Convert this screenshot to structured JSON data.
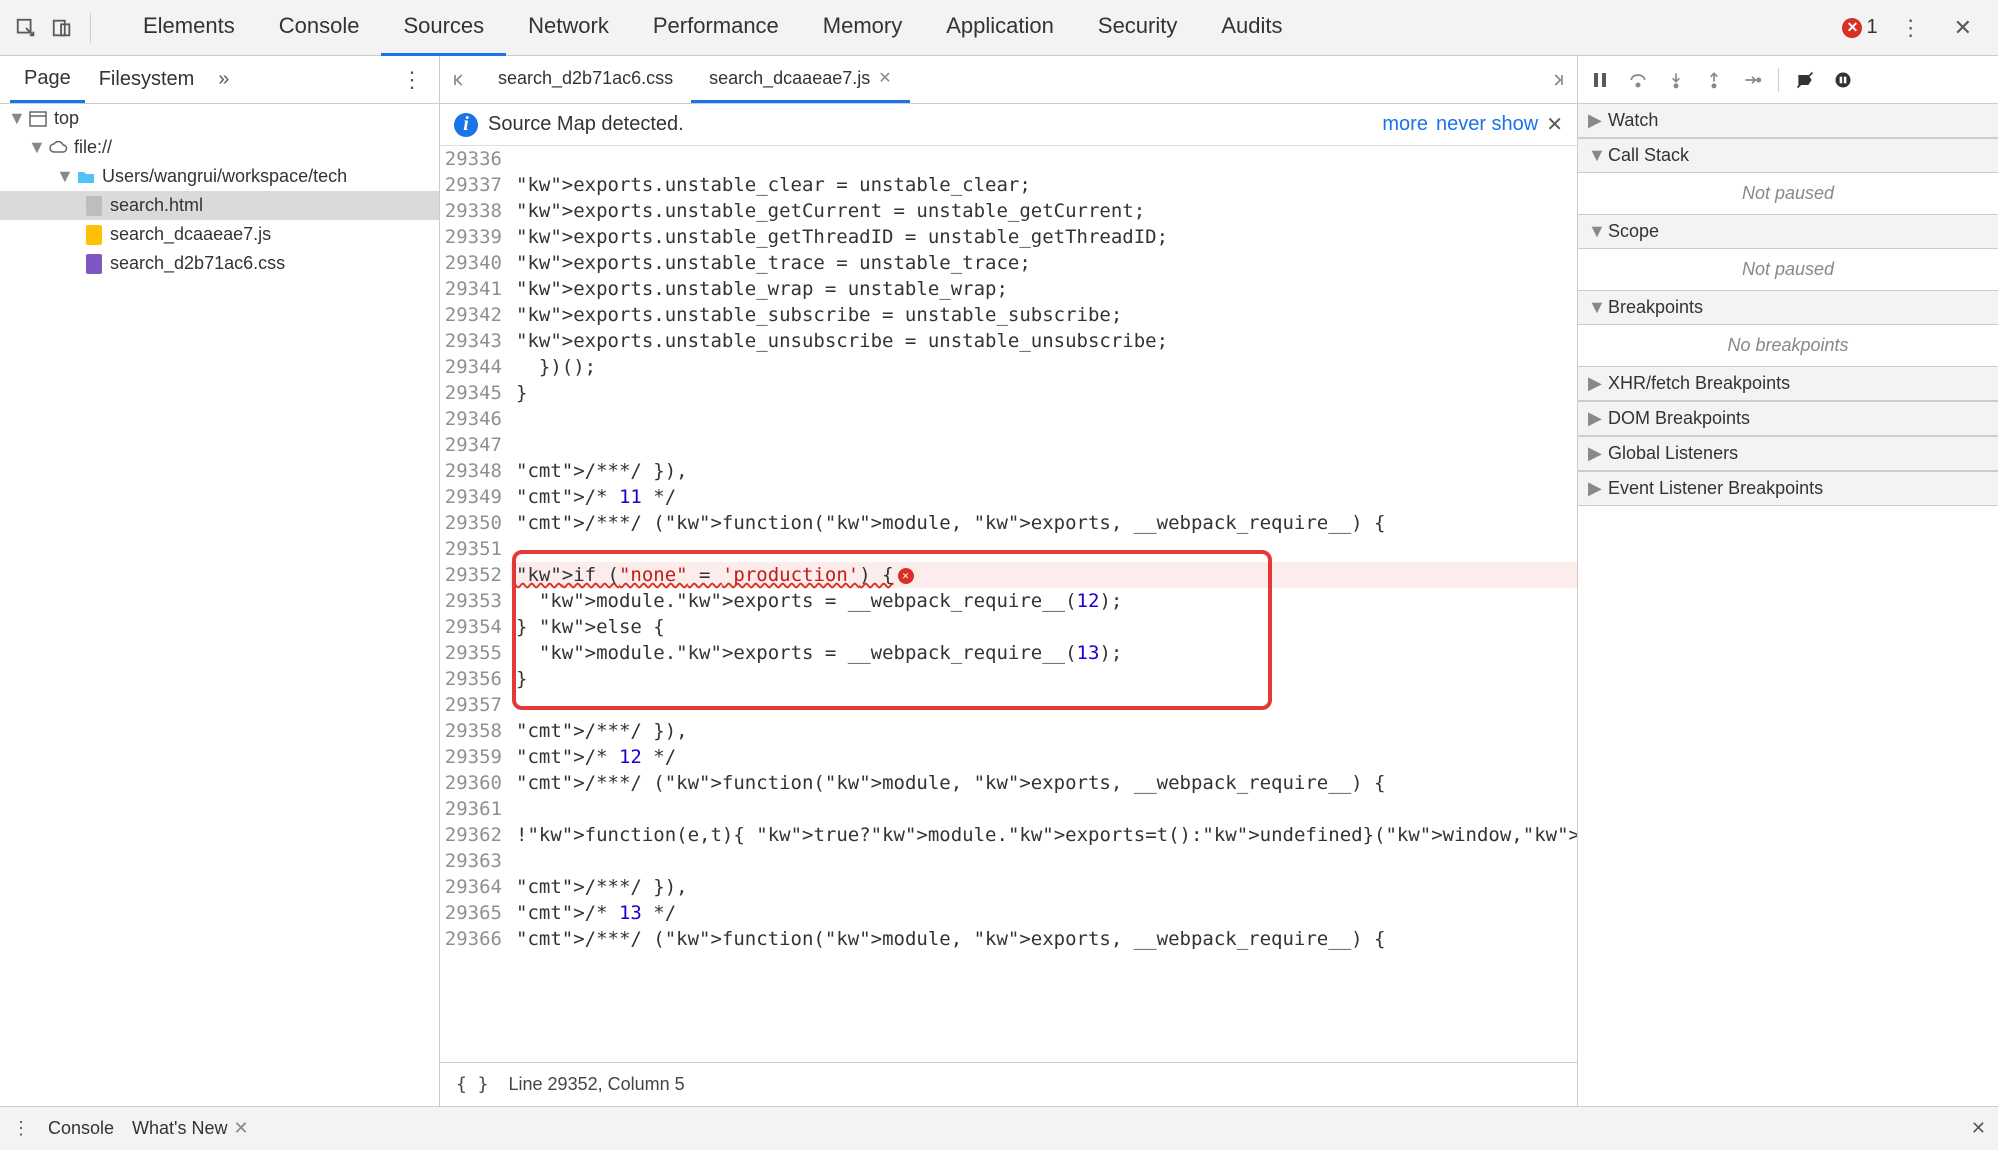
{
  "mainTabs": [
    "Elements",
    "Console",
    "Sources",
    "Network",
    "Performance",
    "Memory",
    "Application",
    "Security",
    "Audits"
  ],
  "mainActive": "Sources",
  "errorCount": "1",
  "leftTabs": {
    "page": "Page",
    "filesystem": "Filesystem",
    "more": "»"
  },
  "editorTabs": {
    "css": "search_d2b71ac6.css",
    "js": "search_dcaaeae7.js"
  },
  "infoBar": {
    "text": "Source Map detected.",
    "more": "more",
    "never": "never show"
  },
  "tree": {
    "top": "top",
    "file": "file://",
    "path": "Users/wangrui/workspace/tech",
    "html": "search.html",
    "js": "search_dcaaeae7.js",
    "css": "search_d2b71ac6.css"
  },
  "code": {
    "start": 29336,
    "lines": [
      "",
      "exports.unstable_clear = unstable_clear;",
      "exports.unstable_getCurrent = unstable_getCurrent;",
      "exports.unstable_getThreadID = unstable_getThreadID;",
      "exports.unstable_trace = unstable_trace;",
      "exports.unstable_wrap = unstable_wrap;",
      "exports.unstable_subscribe = unstable_subscribe;",
      "exports.unstable_unsubscribe = unstable_unsubscribe;",
      "  })();",
      "}",
      "",
      "",
      "/***/ }),",
      "/* 11 */",
      "/***/ (function(module, exports, __webpack_require__) {",
      "",
      "if (\"none\" = 'production') {",
      "  module.exports = __webpack_require__(12);",
      "} else {",
      "  module.exports = __webpack_require__(13);",
      "}",
      "",
      "/***/ }),",
      "/* 12 */",
      "/***/ (function(module, exports, __webpack_require__) {",
      "",
      "!function(e,t){ true?module.exports=t():undefined}(window,function(){",
      "",
      "/***/ }),",
      "/* 13 */",
      "/***/ (function(module, exports, __webpack_require__) {"
    ],
    "errorLine": 29352,
    "boxStart": 29351,
    "boxEnd": 29357
  },
  "status": {
    "pretty": "{ }",
    "pos": "Line 29352, Column 5"
  },
  "panes": {
    "watch": "Watch",
    "callstack": "Call Stack",
    "callstack_body": "Not paused",
    "scope": "Scope",
    "scope_body": "Not paused",
    "breakpoints": "Breakpoints",
    "breakpoints_body": "No breakpoints",
    "xhr": "XHR/fetch Breakpoints",
    "dom": "DOM Breakpoints",
    "global": "Global Listeners",
    "event": "Event Listener Breakpoints"
  },
  "drawer": {
    "console": "Console",
    "whatsnew": "What's New"
  }
}
